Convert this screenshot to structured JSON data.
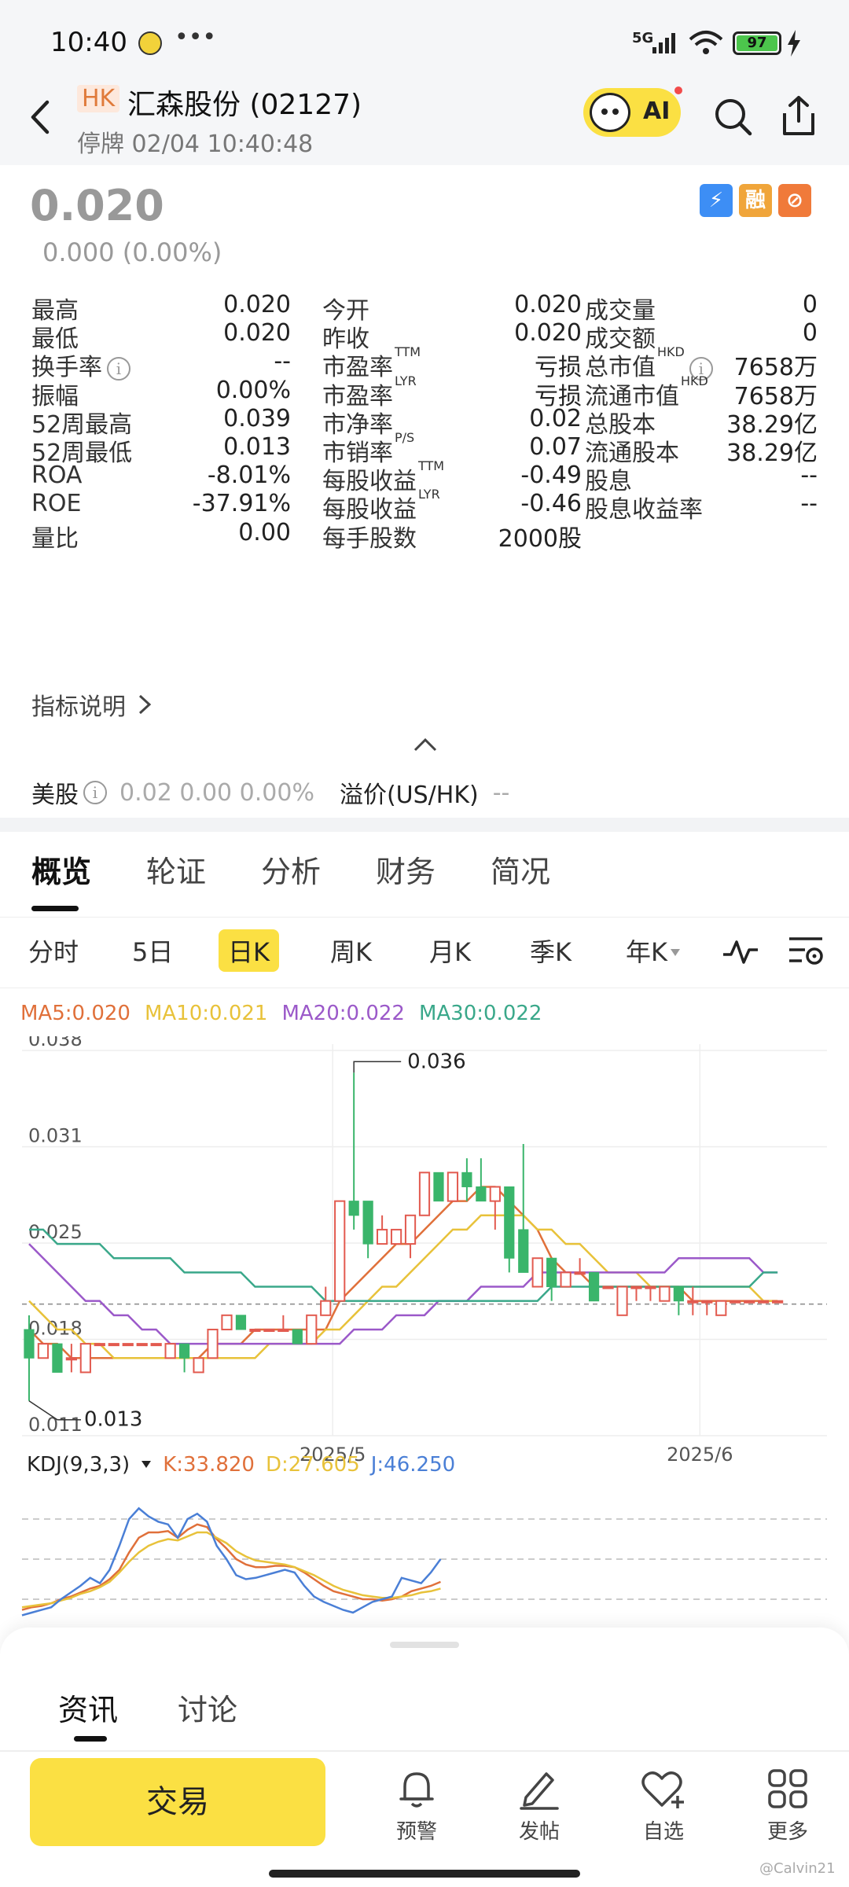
{
  "status_bar": {
    "time": "10:40",
    "dots": "•••",
    "network": "5G",
    "battery": "97"
  },
  "header": {
    "market_tag": "HK",
    "stock_name": "汇森股份 (02127)",
    "status_line": "停牌 02/04 10:40:48",
    "ai_label": "AI"
  },
  "quote": {
    "price": "0.020",
    "change": "0.000 (0.00%)",
    "badges": [
      {
        "label": "⚡",
        "color": "#3d8ef5"
      },
      {
        "label": "融",
        "color": "#f0a53a"
      },
      {
        "label": "⊘",
        "color": "#f07a3a"
      }
    ]
  },
  "stats": [
    [
      {
        "label": "最高",
        "sup": "",
        "value": "0.020"
      },
      {
        "label": "今开",
        "sup": "",
        "value": "0.020"
      },
      {
        "label": "成交量",
        "sup": "",
        "value": "0"
      }
    ],
    [
      {
        "label": "最低",
        "sup": "",
        "value": "0.020"
      },
      {
        "label": "昨收",
        "sup": "",
        "value": "0.020"
      },
      {
        "label": "成交额",
        "sup": "",
        "value": "0"
      }
    ],
    [
      {
        "label": "换手率",
        "sup": "",
        "value": "--",
        "info": true
      },
      {
        "label": "市盈率",
        "sup": "TTM",
        "value": "亏损"
      },
      {
        "label": "总市值",
        "sup": "HKD",
        "value": "7658万",
        "info": true
      }
    ],
    [
      {
        "label": "振幅",
        "sup": "",
        "value": "0.00%"
      },
      {
        "label": "市盈率",
        "sup": "LYR",
        "value": "亏损"
      },
      {
        "label": "流通市值",
        "sup": "HKD",
        "value": "7658万"
      }
    ],
    [
      {
        "label": "52周最高",
        "sup": "",
        "value": "0.039"
      },
      {
        "label": "市净率",
        "sup": "",
        "value": "0.02"
      },
      {
        "label": "总股本",
        "sup": "",
        "value": "38.29亿"
      }
    ],
    [
      {
        "label": "52周最低",
        "sup": "",
        "value": "0.013"
      },
      {
        "label": "市销率",
        "sup": "P/S",
        "value": "0.07"
      },
      {
        "label": "流通股本",
        "sup": "",
        "value": "38.29亿"
      }
    ],
    [
      {
        "label": "ROA",
        "sup": "",
        "value": "-8.01%"
      },
      {
        "label": "每股收益",
        "sup": "TTM",
        "value": "-0.49"
      },
      {
        "label": "股息",
        "sup": "",
        "value": "--"
      }
    ],
    [
      {
        "label": "ROE",
        "sup": "",
        "value": "-37.91%"
      },
      {
        "label": "每股收益",
        "sup": "LYR",
        "value": "-0.46"
      },
      {
        "label": "股息收益率",
        "sup": "",
        "value": "--"
      }
    ],
    [
      {
        "label": "量比",
        "sup": "",
        "value": "0.00"
      },
      {
        "label": "每手股数",
        "sup": "",
        "value": "2000股"
      },
      {
        "label": "",
        "sup": "",
        "value": ""
      }
    ]
  ],
  "indicator_link": "指标说明",
  "us_row": {
    "label": "美股",
    "values": "0.02  0.00  0.00%",
    "premium_label": "溢价(US/HK)",
    "premium_value": "--"
  },
  "tabs": [
    "概览",
    "轮证",
    "分析",
    "财务",
    "简况"
  ],
  "periods": [
    "分时",
    "5日",
    "日K",
    "周K",
    "月K",
    "季K",
    "年K"
  ],
  "ma": [
    {
      "label": "MA5:0.020",
      "color": "#e0703a"
    },
    {
      "label": "MA10:0.021",
      "color": "#e8c23a"
    },
    {
      "label": "MA20:0.022",
      "color": "#9b59c9"
    },
    {
      "label": "MA30:0.022",
      "color": "#3aa88a"
    }
  ],
  "chart_data": {
    "type": "candlestick",
    "y_ticks": [
      "0.038",
      "0.031",
      "0.025",
      "0.018",
      "0.011"
    ],
    "x_ticks": [
      "2025/5",
      "2025/6"
    ],
    "annotations": {
      "high": "0.036",
      "low": "0.013"
    },
    "reference_price": 0.02,
    "ylim": [
      0.011,
      0.038
    ],
    "candles": [
      {
        "o": 0.018,
        "c": 0.016,
        "h": 0.019,
        "l": 0.013
      },
      {
        "o": 0.016,
        "c": 0.017,
        "h": 0.017,
        "l": 0.016
      },
      {
        "o": 0.017,
        "c": 0.015,
        "h": 0.017,
        "l": 0.015
      },
      {
        "o": 0.016,
        "c": 0.016,
        "h": 0.017,
        "l": 0.015
      },
      {
        "o": 0.015,
        "c": 0.017,
        "h": 0.017,
        "l": 0.015
      },
      {
        "o": 0.017,
        "c": 0.017,
        "h": 0.017,
        "l": 0.017
      },
      {
        "o": 0.017,
        "c": 0.017,
        "h": 0.017,
        "l": 0.017
      },
      {
        "o": 0.017,
        "c": 0.017,
        "h": 0.017,
        "l": 0.017
      },
      {
        "o": 0.017,
        "c": 0.017,
        "h": 0.017,
        "l": 0.017
      },
      {
        "o": 0.017,
        "c": 0.017,
        "h": 0.017,
        "l": 0.017
      },
      {
        "o": 0.016,
        "c": 0.017,
        "h": 0.017,
        "l": 0.016
      },
      {
        "o": 0.017,
        "c": 0.016,
        "h": 0.017,
        "l": 0.015
      },
      {
        "o": 0.015,
        "c": 0.016,
        "h": 0.016,
        "l": 0.015
      },
      {
        "o": 0.016,
        "c": 0.018,
        "h": 0.018,
        "l": 0.016
      },
      {
        "o": 0.018,
        "c": 0.019,
        "h": 0.019,
        "l": 0.018
      },
      {
        "o": 0.019,
        "c": 0.018,
        "h": 0.019,
        "l": 0.018
      },
      {
        "o": 0.018,
        "c": 0.018,
        "h": 0.018,
        "l": 0.018
      },
      {
        "o": 0.018,
        "c": 0.018,
        "h": 0.018,
        "l": 0.018
      },
      {
        "o": 0.018,
        "c": 0.018,
        "h": 0.019,
        "l": 0.018
      },
      {
        "o": 0.018,
        "c": 0.017,
        "h": 0.018,
        "l": 0.017
      },
      {
        "o": 0.017,
        "c": 0.019,
        "h": 0.019,
        "l": 0.017
      },
      {
        "o": 0.019,
        "c": 0.02,
        "h": 0.021,
        "l": 0.019
      },
      {
        "o": 0.02,
        "c": 0.027,
        "h": 0.027,
        "l": 0.02
      },
      {
        "o": 0.027,
        "c": 0.026,
        "h": 0.036,
        "l": 0.025
      },
      {
        "o": 0.027,
        "c": 0.024,
        "h": 0.027,
        "l": 0.023
      },
      {
        "o": 0.024,
        "c": 0.025,
        "h": 0.026,
        "l": 0.024
      },
      {
        "o": 0.024,
        "c": 0.025,
        "h": 0.025,
        "l": 0.024
      },
      {
        "o": 0.024,
        "c": 0.026,
        "h": 0.026,
        "l": 0.023
      },
      {
        "o": 0.026,
        "c": 0.029,
        "h": 0.029,
        "l": 0.026
      },
      {
        "o": 0.029,
        "c": 0.027,
        "h": 0.029,
        "l": 0.027
      },
      {
        "o": 0.027,
        "c": 0.029,
        "h": 0.029,
        "l": 0.027
      },
      {
        "o": 0.029,
        "c": 0.028,
        "h": 0.03,
        "l": 0.027
      },
      {
        "o": 0.028,
        "c": 0.027,
        "h": 0.03,
        "l": 0.027
      },
      {
        "o": 0.027,
        "c": 0.028,
        "h": 0.028,
        "l": 0.025
      },
      {
        "o": 0.028,
        "c": 0.023,
        "h": 0.028,
        "l": 0.022
      },
      {
        "o": 0.025,
        "c": 0.022,
        "h": 0.031,
        "l": 0.022
      },
      {
        "o": 0.021,
        "c": 0.023,
        "h": 0.023,
        "l": 0.021
      },
      {
        "o": 0.023,
        "c": 0.021,
        "h": 0.023,
        "l": 0.02
      },
      {
        "o": 0.021,
        "c": 0.022,
        "h": 0.022,
        "l": 0.021
      },
      {
        "o": 0.022,
        "c": 0.022,
        "h": 0.023,
        "l": 0.022
      },
      {
        "o": 0.022,
        "c": 0.02,
        "h": 0.022,
        "l": 0.02
      },
      {
        "o": 0.021,
        "c": 0.021,
        "h": 0.021,
        "l": 0.021
      },
      {
        "o": 0.019,
        "c": 0.021,
        "h": 0.021,
        "l": 0.019
      },
      {
        "o": 0.021,
        "c": 0.021,
        "h": 0.021,
        "l": 0.02
      },
      {
        "o": 0.021,
        "c": 0.021,
        "h": 0.021,
        "l": 0.02
      },
      {
        "o": 0.02,
        "c": 0.021,
        "h": 0.021,
        "l": 0.02
      },
      {
        "o": 0.021,
        "c": 0.02,
        "h": 0.021,
        "l": 0.019
      },
      {
        "o": 0.02,
        "c": 0.02,
        "h": 0.021,
        "l": 0.019
      },
      {
        "o": 0.02,
        "c": 0.02,
        "h": 0.02,
        "l": 0.019
      },
      {
        "o": 0.019,
        "c": 0.02,
        "h": 0.02,
        "l": 0.019
      },
      {
        "o": 0.02,
        "c": 0.02,
        "h": 0.02,
        "l": 0.02
      },
      {
        "o": 0.02,
        "c": 0.02,
        "h": 0.02,
        "l": 0.02
      },
      {
        "o": 0.02,
        "c": 0.02,
        "h": 0.02,
        "l": 0.02
      },
      {
        "o": 0.02,
        "c": 0.02,
        "h": 0.02,
        "l": 0.02
      }
    ],
    "ma5": [
      0.018,
      0.017,
      0.017,
      0.016,
      0.016,
      0.016,
      0.016,
      0.016,
      0.016,
      0.016,
      0.016,
      0.016,
      0.016,
      0.017,
      0.017,
      0.017,
      0.018,
      0.018,
      0.018,
      0.018,
      0.018,
      0.018,
      0.02,
      0.021,
      0.022,
      0.023,
      0.024,
      0.024,
      0.025,
      0.026,
      0.027,
      0.027,
      0.028,
      0.028,
      0.027,
      0.026,
      0.025,
      0.023,
      0.022,
      0.022,
      0.021,
      0.021,
      0.021,
      0.021,
      0.021,
      0.021,
      0.021,
      0.02,
      0.02,
      0.02,
      0.02,
      0.02,
      0.02,
      0.02
    ],
    "ma10": [
      0.02,
      0.019,
      0.018,
      0.018,
      0.017,
      0.017,
      0.016,
      0.016,
      0.016,
      0.016,
      0.016,
      0.016,
      0.016,
      0.016,
      0.016,
      0.016,
      0.016,
      0.017,
      0.017,
      0.017,
      0.017,
      0.018,
      0.018,
      0.019,
      0.02,
      0.021,
      0.021,
      0.022,
      0.023,
      0.024,
      0.025,
      0.025,
      0.026,
      0.026,
      0.026,
      0.026,
      0.025,
      0.025,
      0.024,
      0.024,
      0.023,
      0.022,
      0.022,
      0.022,
      0.021,
      0.021,
      0.021,
      0.021,
      0.021,
      0.021,
      0.021,
      0.021,
      0.02,
      0.02
    ],
    "ma20": [
      0.024,
      0.023,
      0.022,
      0.021,
      0.02,
      0.02,
      0.019,
      0.019,
      0.018,
      0.018,
      0.017,
      0.017,
      0.017,
      0.017,
      0.017,
      0.017,
      0.017,
      0.017,
      0.017,
      0.017,
      0.017,
      0.017,
      0.017,
      0.018,
      0.018,
      0.018,
      0.019,
      0.019,
      0.019,
      0.02,
      0.02,
      0.02,
      0.021,
      0.021,
      0.021,
      0.021,
      0.022,
      0.022,
      0.022,
      0.022,
      0.022,
      0.022,
      0.022,
      0.022,
      0.022,
      0.022,
      0.023,
      0.023,
      0.023,
      0.023,
      0.023,
      0.023,
      0.022,
      0.022
    ],
    "ma30": [
      0.025,
      0.025,
      0.024,
      0.024,
      0.024,
      0.024,
      0.023,
      0.023,
      0.023,
      0.023,
      0.023,
      0.022,
      0.022,
      0.022,
      0.022,
      0.022,
      0.021,
      0.021,
      0.021,
      0.021,
      0.021,
      0.02,
      0.02,
      0.02,
      0.02,
      0.02,
      0.02,
      0.02,
      0.02,
      0.02,
      0.02,
      0.02,
      0.02,
      0.02,
      0.02,
      0.02,
      0.02,
      0.021,
      0.021,
      0.021,
      0.021,
      0.021,
      0.021,
      0.021,
      0.021,
      0.021,
      0.021,
      0.021,
      0.021,
      0.021,
      0.021,
      0.021,
      0.022,
      0.022
    ]
  },
  "kdj": {
    "label": "KDJ(9,3,3)",
    "k_label": "K:33.820",
    "d_label": "D:27.605",
    "j_label": "J:46.250",
    "k_color": "#e0703a",
    "d_color": "#e8c23a",
    "j_color": "#4a7fd6",
    "k": [
      12,
      14,
      15,
      17,
      20,
      22,
      25,
      28,
      30,
      35,
      42,
      55,
      66,
      70,
      70,
      71,
      66,
      72,
      76,
      74,
      65,
      58,
      50,
      46,
      44,
      44,
      45,
      45,
      44,
      40,
      35,
      30,
      26,
      24,
      22,
      20,
      20,
      19,
      20,
      22,
      26,
      28,
      30,
      33
    ],
    "d": [
      14,
      15,
      16,
      17,
      19,
      21,
      24,
      26,
      29,
      33,
      40,
      48,
      55,
      60,
      63,
      65,
      64,
      67,
      70,
      70,
      66,
      62,
      56,
      52,
      49,
      48,
      47,
      46,
      44,
      41,
      38,
      34,
      30,
      27,
      25,
      23,
      22,
      21,
      21,
      22,
      23,
      25,
      26,
      28
    ],
    "j": [
      8,
      10,
      12,
      14,
      20,
      25,
      30,
      36,
      32,
      42,
      60,
      80,
      88,
      82,
      78,
      76,
      66,
      80,
      84,
      78,
      60,
      50,
      38,
      35,
      36,
      38,
      40,
      42,
      40,
      30,
      22,
      18,
      15,
      12,
      10,
      14,
      18,
      20,
      22,
      36,
      34,
      32,
      40,
      50
    ]
  },
  "bottom_tabs": [
    "资讯",
    "讨论"
  ],
  "trade_button": "交易",
  "nav": [
    "预警",
    "发帖",
    "自选",
    "更多"
  ],
  "watermark": "@Calvin21"
}
